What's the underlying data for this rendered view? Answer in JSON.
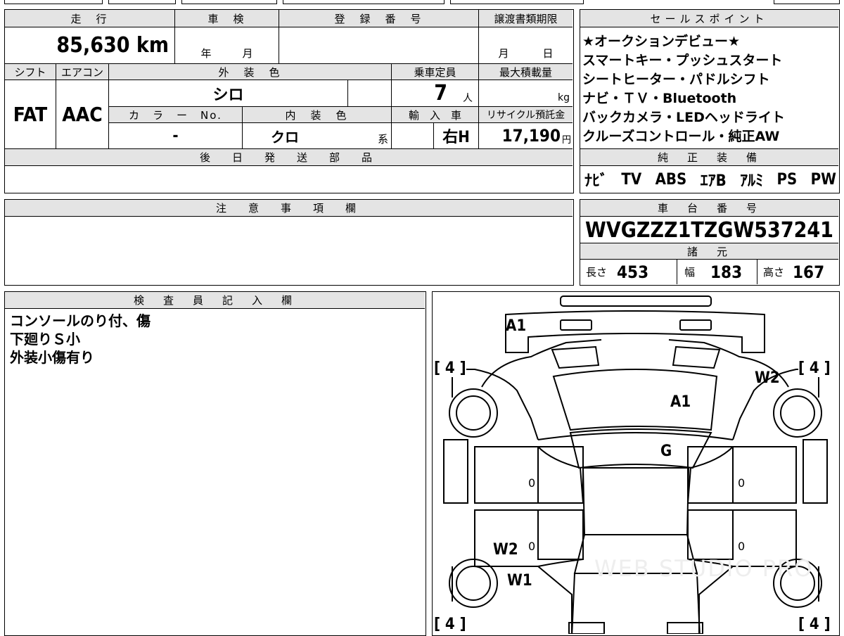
{
  "header": {
    "mileage_label": "走　行",
    "inspection_label": "車　検",
    "registration_label": "登　録　番　号",
    "transfer_deadline_label": "譲渡書類期限",
    "mileage_value": "85,630 km",
    "inspection_year": "年",
    "inspection_month": "月",
    "transfer_month": "月",
    "transfer_day": "日"
  },
  "row2": {
    "shift_label": "シフト",
    "aircon_label": "エアコン",
    "exterior_color_label": "外　装　色",
    "capacity_label": "乗車定員",
    "max_load_label": "最大積載量",
    "shift_value": "FAT",
    "aircon_value": "AAC",
    "exterior_color_value": "シロ",
    "capacity_value": "7",
    "capacity_unit": "人",
    "max_load_unit": "kg",
    "color_no_label": "カ　ラ　ー　No.",
    "interior_color_label": "内　装　色",
    "import_label": "輸　入　車",
    "recycle_label": "リサイクル預託金",
    "color_no_value": "-",
    "interior_color_value": "クロ",
    "interior_suffix": "系",
    "import_value": "右H",
    "recycle_value": "17,190",
    "recycle_unit": "円"
  },
  "later_parts": {
    "label": "後　日　発　送　部　品"
  },
  "sales_points": {
    "label": "セールスポイント",
    "lines": [
      "★オークションデビュー★",
      "スマートキー・プッシュスタート",
      "シートヒーター・パドルシフト",
      "ナビ・ＴＶ・Bluetooth",
      "バックカメラ・LEDヘッドライト",
      "クルーズコントロール・純正AW"
    ]
  },
  "standard_equipment": {
    "label": "純　正　装　備",
    "items": [
      "ﾅﾋﾞ",
      "TV",
      "ABS",
      "ｴｱB",
      "ｱﾙﾐ",
      "PS",
      "PW"
    ]
  },
  "notes": {
    "label": "注　意　事　項　欄"
  },
  "chassis": {
    "label": "車　台　番　号",
    "value": "WVGZZZ1TZGW537241",
    "specs_label": "諸　元",
    "length_label": "長さ",
    "length_value": "453",
    "width_label": "幅",
    "width_value": "183",
    "height_label": "高さ",
    "height_value": "167"
  },
  "inspector": {
    "label": "検　査　員　記　入　欄",
    "lines": [
      "コンソールのり付、傷",
      "下廻りＳ小",
      "外装小傷有り"
    ]
  },
  "diagram": {
    "front_bumper": "A1",
    "hood": "A1",
    "windshield": "G",
    "right_front_fender": "W2",
    "left_rear_door": "W2",
    "left_rear_quarter": "W1",
    "tire_fl": "[ 4 ]",
    "tire_fr": "[ 4 ]",
    "tire_rl": "[ 4 ]",
    "tire_rr": "[ 4 ]",
    "door_marks": [
      "0",
      "0",
      "0",
      "0"
    ],
    "watermark": "WEB STUDIO PRO"
  }
}
